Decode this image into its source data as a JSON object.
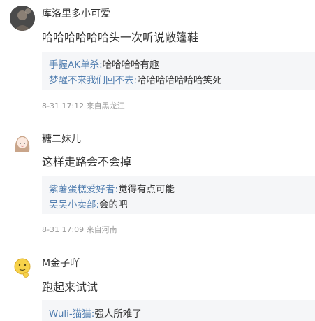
{
  "comments": [
    {
      "username": "库洛里多小可爱",
      "content": "哈哈哈哈哈哈头一次听说敞篷鞋",
      "replies": [
        {
          "name": "手握AK单杀",
          "text": "哈哈哈哈有趣"
        },
        {
          "name": "梦醒不来我们回不去",
          "text": "哈哈哈哈哈哈哈笑死"
        }
      ],
      "meta": "8-31 17:12 来自黑龙江"
    },
    {
      "username": "糖二妹儿",
      "content": "这样走路会不会掉",
      "replies": [
        {
          "name": "紫薯蛋糕爱好者",
          "text": "觉得有点可能"
        },
        {
          "name": "吴吴小卖部",
          "text": "会的吧"
        }
      ],
      "meta": "8-31 17:09 来自河南"
    },
    {
      "username": "M金子吖",
      "content": "跑起来试试",
      "replies": [
        {
          "name": "Wuli-猫猫",
          "text": "强人所难了"
        }
      ]
    }
  ],
  "reply_separator": ":",
  "colors": {
    "link": "#507daf",
    "reply_bg": "#f5f6f8",
    "meta": "#999999",
    "text": "#333333"
  },
  "icons": {
    "avatar1": "user-avatar-photo",
    "avatar2": "girl-avatar",
    "avatar3": "emoji-avatar"
  }
}
